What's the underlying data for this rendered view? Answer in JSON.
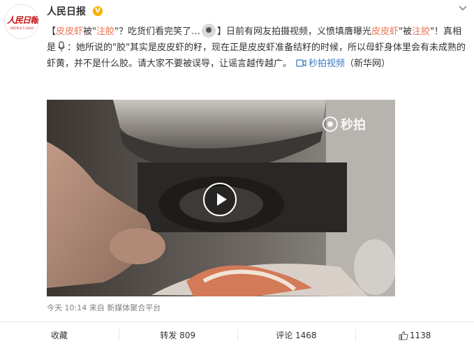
{
  "account": {
    "name": "人民日报",
    "verified": "V",
    "logo_text": "人民日報",
    "logo_subtext": "PEOPLE'S DAILY"
  },
  "post": {
    "segments": {
      "s1": "【",
      "s2": "皮皮虾",
      "s3": "被\"",
      "s4": "注胶",
      "s5": "\"？吃货们看完笑了…",
      "s6": "】日前有网友拍摄视频，义愤填膺曝光",
      "s7": "皮皮虾",
      "s8": "\"被",
      "s9": "注胶",
      "s10": "\"！真相是",
      "s11": "：她所说的\"胶\"其实是皮皮虾的籽，现在正是皮皮虾准备结籽的时候，所以母虾身体里会有未成熟的虾黄，并不是什么胶。请大家不要被误导，让谣言越传越广。",
      "link": "秒拍视频",
      "s12": "（新华网）"
    }
  },
  "video": {
    "watermark": "秒拍"
  },
  "meta": {
    "time": "今天 10:14",
    "source_prefix": "来自",
    "source": "新媒体聚合平台"
  },
  "actions": {
    "favorite": "收藏",
    "repost": "转发 809",
    "comment": "评论 1468",
    "like": "1138"
  },
  "colors": {
    "accent": "#eb7350",
    "link": "#3c7abf",
    "verified": "#f7b100"
  }
}
